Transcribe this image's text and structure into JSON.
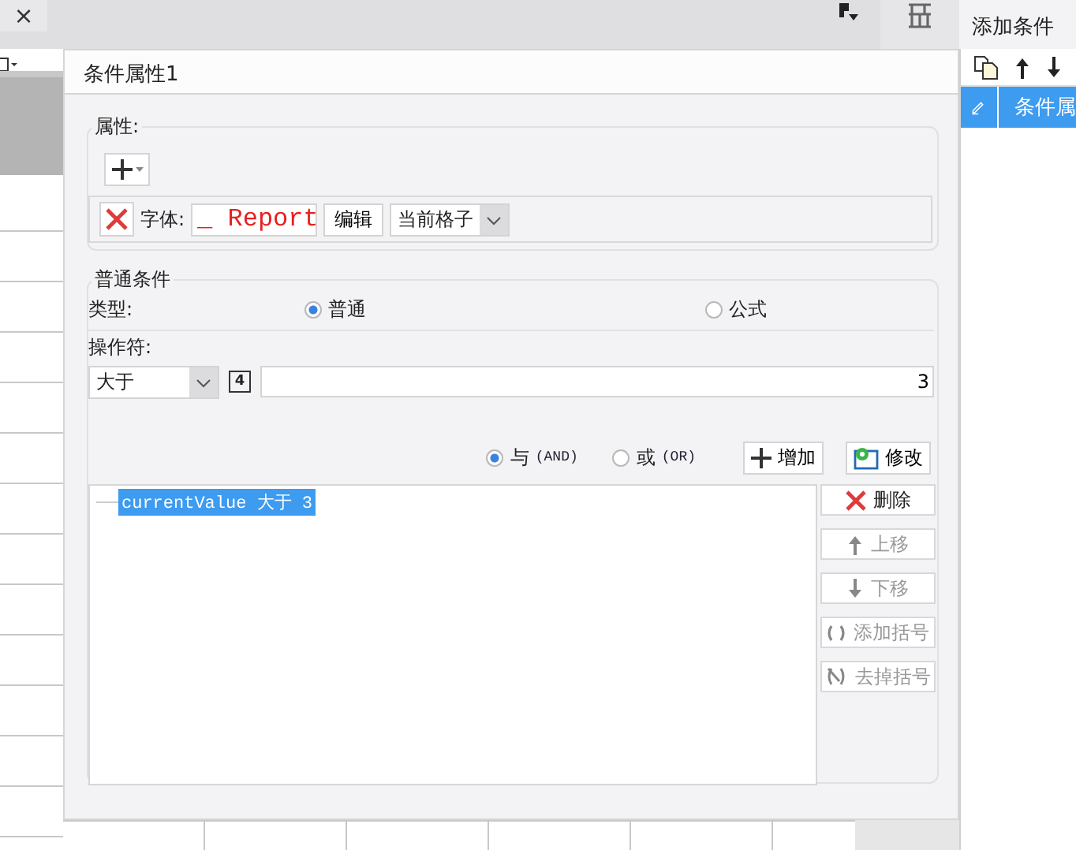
{
  "tab_close": "×",
  "right_panel": {
    "title": "添加条件",
    "items": [
      {
        "label": "条件属",
        "selected": true
      }
    ]
  },
  "dialog": {
    "title": "条件属性1",
    "property_group": {
      "legend": "属性:",
      "font_label": "字体:",
      "font_preview": "_ Report",
      "edit_button": "编辑",
      "scope": "当前格子"
    },
    "condition_group": {
      "legend": "普通条件",
      "type_label": "类型:",
      "types": [
        {
          "label": "普通",
          "selected": true
        },
        {
          "label": "公式",
          "selected": false
        }
      ],
      "operator_label": "操作符:",
      "operator": "大于",
      "formula_icon": "4",
      "value": "3",
      "logic": [
        {
          "label": "与",
          "suffix": "(AND)",
          "selected": true
        },
        {
          "label": "或",
          "suffix": "(OR)",
          "selected": false
        }
      ],
      "actions": [
        {
          "kind": "add",
          "label": "增加"
        },
        {
          "kind": "modify",
          "label": "修改"
        }
      ],
      "conditions": [
        {
          "text": "currentValue 大于 3",
          "selected": true
        }
      ],
      "list_buttons": [
        {
          "kind": "delete",
          "label": "删除",
          "disabled": false
        },
        {
          "kind": "up",
          "label": "上移",
          "disabled": true
        },
        {
          "kind": "down",
          "label": "下移",
          "disabled": true
        },
        {
          "kind": "add_bracket",
          "label": "添加括号",
          "disabled": true
        },
        {
          "kind": "remove_bracket",
          "label": "去掉括号",
          "disabled": true
        }
      ]
    }
  }
}
